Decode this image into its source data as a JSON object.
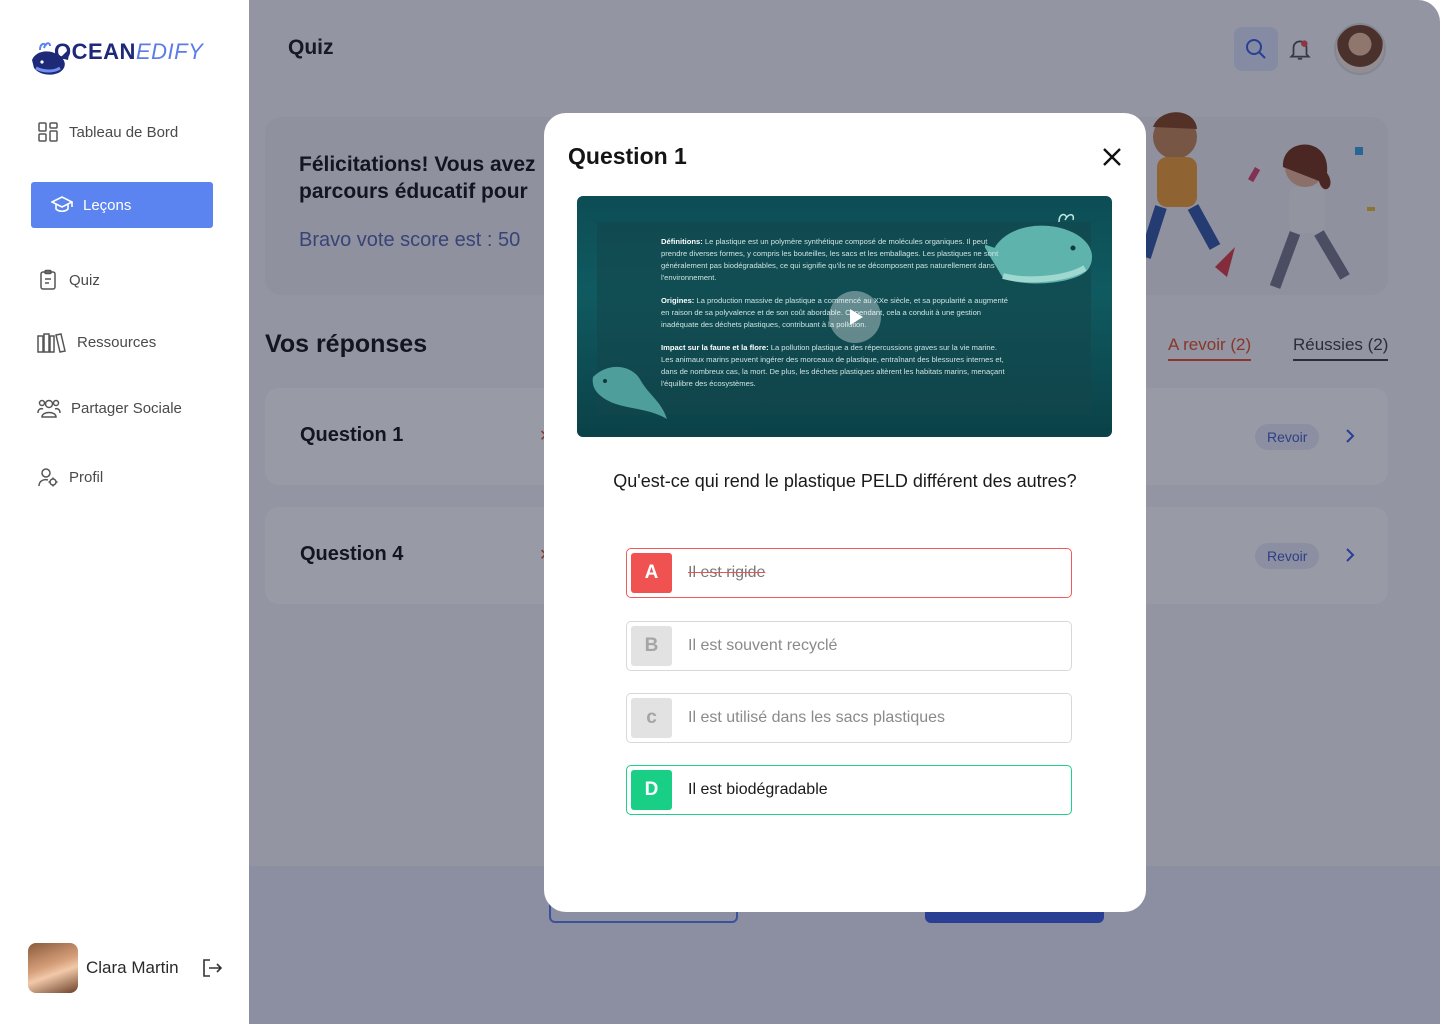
{
  "brand": {
    "part1": "OCEAN",
    "part2": "EDIFY"
  },
  "sidebar": {
    "items": [
      {
        "label": "Tableau de Bord",
        "icon": "dashboard-icon"
      },
      {
        "label": "Leçons",
        "icon": "graduation-cap-icon",
        "active": true
      },
      {
        "label": "Quiz",
        "icon": "clipboard-icon"
      },
      {
        "label": "Ressources",
        "icon": "books-icon"
      },
      {
        "label": "Partager Sociale",
        "icon": "users-icon"
      },
      {
        "label": "Profil",
        "icon": "user-settings-icon"
      }
    ],
    "user_name": "Clara Martin"
  },
  "header": {
    "title": "Quiz"
  },
  "hero": {
    "message": "Félicitations! Vous avez parcours éducatif pour",
    "score": "Bravo vote score est : 50"
  },
  "answers": {
    "title": "Vos réponses",
    "filters": [
      "A revoir (2)",
      "Réussies (2)"
    ],
    "rows": [
      {
        "label": "Question 1",
        "action": "Revoir"
      },
      {
        "label": "Question 4",
        "action": "Revoir"
      }
    ]
  },
  "modal": {
    "title": "Question 1",
    "video": {
      "p1_title": "Définitions:",
      "p1_body": "Le plastique est un polymère synthétique composé de molécules organiques. Il peut prendre diverses formes, y compris les bouteilles, les sacs et les emballages. Les plastiques ne sont généralement pas biodégradables, ce qui signifie qu'ils ne se décomposent pas naturellement dans l'environnement.",
      "p2_title": "Origines:",
      "p2_body": "La production massive de plastique a commencé au XXe siècle, et sa popularité a augmenté en raison de sa polyvalence et de son coût abordable. Cependant, cela a conduit à une gestion inadéquate des déchets plastiques, contribuant à la pollution.",
      "p3_title": "Impact sur la faune et la flore:",
      "p3_body": "La pollution plastique a des répercussions graves sur la vie marine. Les animaux marins peuvent ingérer des morceaux de plastique, entraînant des blessures internes et, dans de nombreux cas, la mort. De plus, les déchets plastiques altèrent les habitats marins, menaçant l'équilibre des écosystèmes."
    },
    "question": "Qu'est-ce qui rend le plastique PELD différent des autres?",
    "options": [
      {
        "letter": "A",
        "text": "Il est rigide",
        "state": "wrong"
      },
      {
        "letter": "B",
        "text": "Il est souvent recyclé",
        "state": "neutral"
      },
      {
        "letter": "c",
        "text": "Il est utilisé dans les sacs plastiques",
        "state": "neutral"
      },
      {
        "letter": "D",
        "text": "Il est biodégradable",
        "state": "correct"
      }
    ]
  },
  "colors": {
    "accent": "#5b84f0",
    "wrong": "#f05252",
    "correct": "#19cf86",
    "warning": "#e3552a"
  }
}
